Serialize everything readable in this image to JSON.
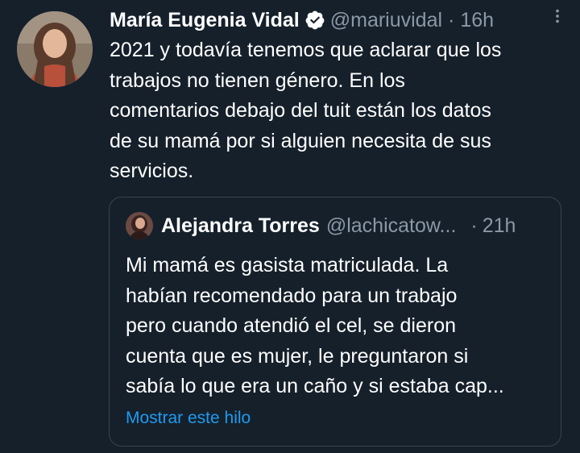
{
  "tweet": {
    "author_name": "María Eugenia Vidal",
    "handle": "@mariuvidal",
    "separator": "·",
    "time": "16h",
    "verified_icon": "verified-badge-icon",
    "more_icon": "more-options-icon",
    "text_lines": [
      "2021 y todavía tenemos que aclarar que los",
      "trabajos no tienen género. En los",
      "comentarios debajo del tuit están los datos",
      "de su mamá por si alguien necesita de sus",
      "servicios."
    ]
  },
  "quote": {
    "author_name": "Alejandra Torres",
    "handle": "@lachicatow...",
    "separator": "·",
    "time": "21h",
    "text_lines": [
      "Mi mamá es gasista matriculada. La",
      "habían recomendado para un trabajo",
      "pero cuando atendió el cel, se dieron",
      "cuenta que es mujer, le preguntaron si",
      "sabía lo que era un caño y si estaba cap..."
    ],
    "show_thread_label": "Mostrar este hilo"
  },
  "colors": {
    "background": "#15202b",
    "text_primary": "#ffffff",
    "text_secondary": "#8b98a5",
    "link": "#1d9bf0",
    "border": "#38444d"
  }
}
